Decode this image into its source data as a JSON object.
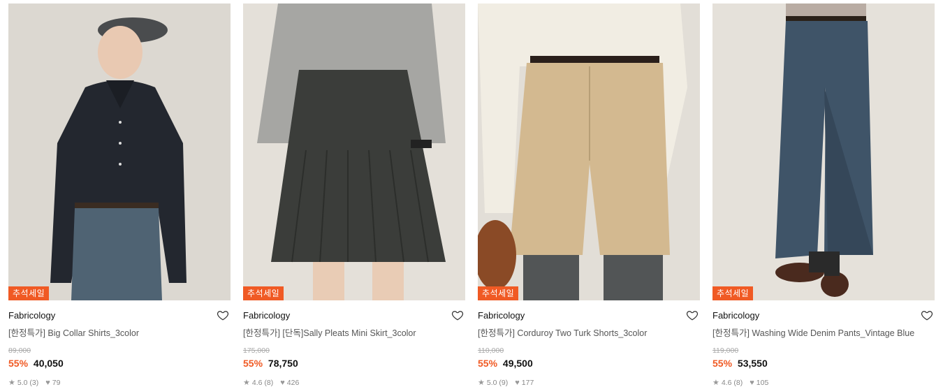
{
  "products": [
    {
      "badge": "추석세일",
      "brand": "Fabricology",
      "name": "[한정특가] Big Collar Shirts_3color",
      "original_price": "89,000",
      "discount": "55%",
      "price": "40,050",
      "rating": "5.0 (3)",
      "likes": "79",
      "colors": {
        "bg": "#dcd8d1",
        "top": "#23272f",
        "bottom": "#4f6373"
      }
    },
    {
      "badge": "추석세일",
      "brand": "Fabricology",
      "name": "[한정특가] [단독]Sally Pleats Mini Skirt_3color",
      "original_price": "175,000",
      "discount": "55%",
      "price": "78,750",
      "rating": "4.6 (8)",
      "likes": "426",
      "colors": {
        "bg": "#e4e0d9",
        "top": "#a6a6a3",
        "bottom": "#3b3d3a"
      }
    },
    {
      "badge": "추석세일",
      "brand": "Fabricology",
      "name": "[한정특가] Corduroy Two Turk Shorts_3color",
      "original_price": "110,000",
      "discount": "55%",
      "price": "49,500",
      "rating": "5.0 (9)",
      "likes": "177",
      "colors": {
        "bg": "#e2ded7",
        "top": "#f1ede3",
        "bottom": "#d3b990"
      }
    },
    {
      "badge": "추석세일",
      "brand": "Fabricology",
      "name": "[한정특가] Washing Wide Denim Pants_Vintage Blue",
      "original_price": "119,000",
      "discount": "55%",
      "price": "53,550",
      "rating": "4.6 (8)",
      "likes": "105",
      "colors": {
        "bg": "#e5e1da",
        "top": "#2e3f52",
        "bottom": "#3f5468"
      }
    }
  ],
  "icons": {
    "heart": "heart-outline-icon",
    "star": "star-icon",
    "like": "heart-filled-icon"
  },
  "accent_color": "#f05a24"
}
